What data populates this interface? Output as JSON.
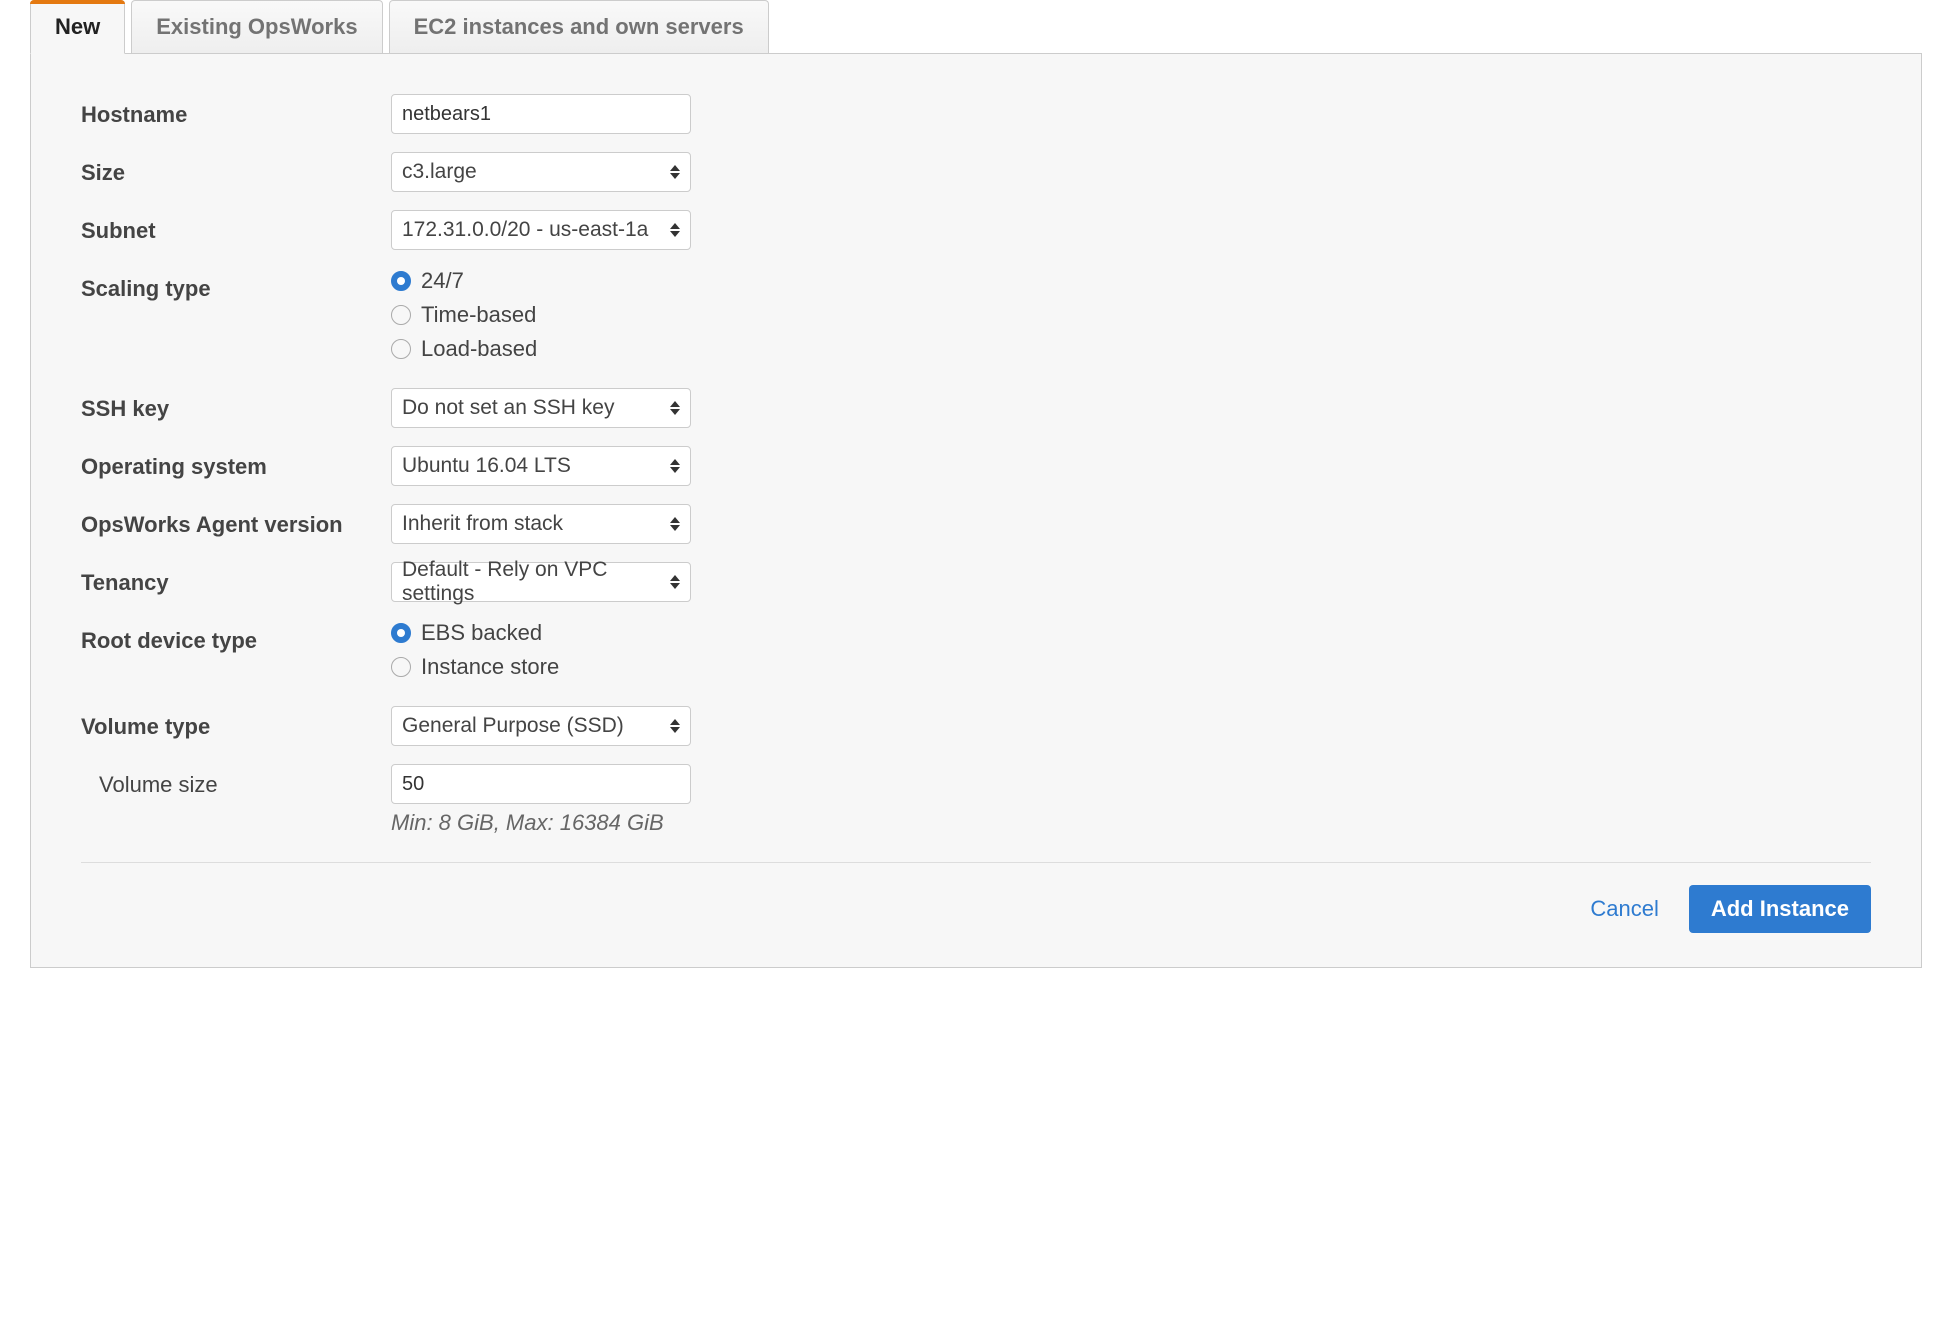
{
  "tabs": {
    "new": "New",
    "existing": "Existing OpsWorks",
    "ec2": "EC2 instances and own servers"
  },
  "form": {
    "hostname": {
      "label": "Hostname",
      "value": "netbears1"
    },
    "size": {
      "label": "Size",
      "value": "c3.large"
    },
    "subnet": {
      "label": "Subnet",
      "value": "172.31.0.0/20 - us-east-1a"
    },
    "scaling_type": {
      "label": "Scaling type",
      "option1": "24/7",
      "option2": "Time-based",
      "option3": "Load-based"
    },
    "ssh_key": {
      "label": "SSH key",
      "value": "Do not set an SSH key"
    },
    "os": {
      "label": "Operating system",
      "value": "Ubuntu 16.04 LTS"
    },
    "agent_version": {
      "label": "OpsWorks Agent version",
      "value": "Inherit from stack"
    },
    "tenancy": {
      "label": "Tenancy",
      "value": "Default - Rely on VPC settings"
    },
    "root_device": {
      "label": "Root device type",
      "option1": "EBS backed",
      "option2": "Instance store"
    },
    "volume_type": {
      "label": "Volume type",
      "value": "General Purpose (SSD)"
    },
    "volume_size": {
      "label": "Volume size",
      "value": "50",
      "hint": "Min: 8 GiB, Max: 16384 GiB"
    }
  },
  "actions": {
    "cancel": "Cancel",
    "add": "Add Instance"
  }
}
